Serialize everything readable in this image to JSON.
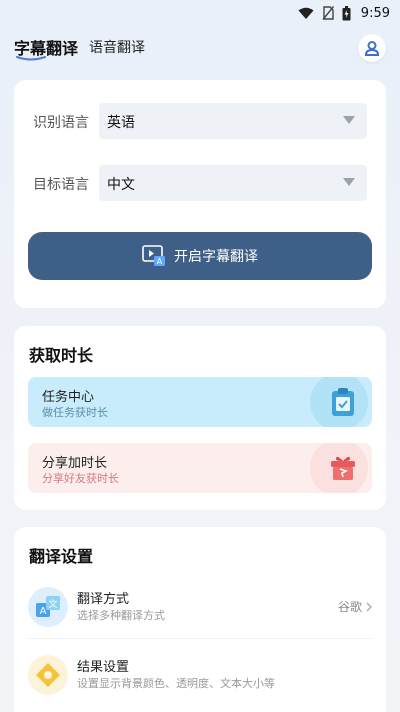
{
  "status_bar": {
    "time": "9:59"
  },
  "header": {
    "tabs": [
      {
        "label": "字幕翻译",
        "active": true
      },
      {
        "label": "语音翻译",
        "active": false
      }
    ]
  },
  "language": {
    "source_label": "识别语言",
    "source_value": "英语",
    "target_label": "目标语言",
    "target_value": "中文",
    "start_button": "开启字幕翻译"
  },
  "time_section": {
    "title": "获取时长",
    "items": [
      {
        "title": "任务中心",
        "subtitle": "做任务获时长",
        "icon": "clipboard-icon"
      },
      {
        "title": "分享加时长",
        "subtitle": "分享好友获时长",
        "icon": "gift-icon"
      }
    ]
  },
  "settings_section": {
    "title": "翻译设置",
    "items": [
      {
        "title": "翻译方式",
        "subtitle": "选择多种翻译方式",
        "value": "谷歌",
        "icon": "translate-icon"
      },
      {
        "title": "结果设置",
        "subtitle": "设置显示背景颜色、透明度、文本大小等",
        "icon": "display-settings-icon"
      }
    ]
  },
  "colors": {
    "primary": "#3e5f87",
    "task_tile": "#c8ecfb",
    "share_tile": "#fdeeee"
  }
}
